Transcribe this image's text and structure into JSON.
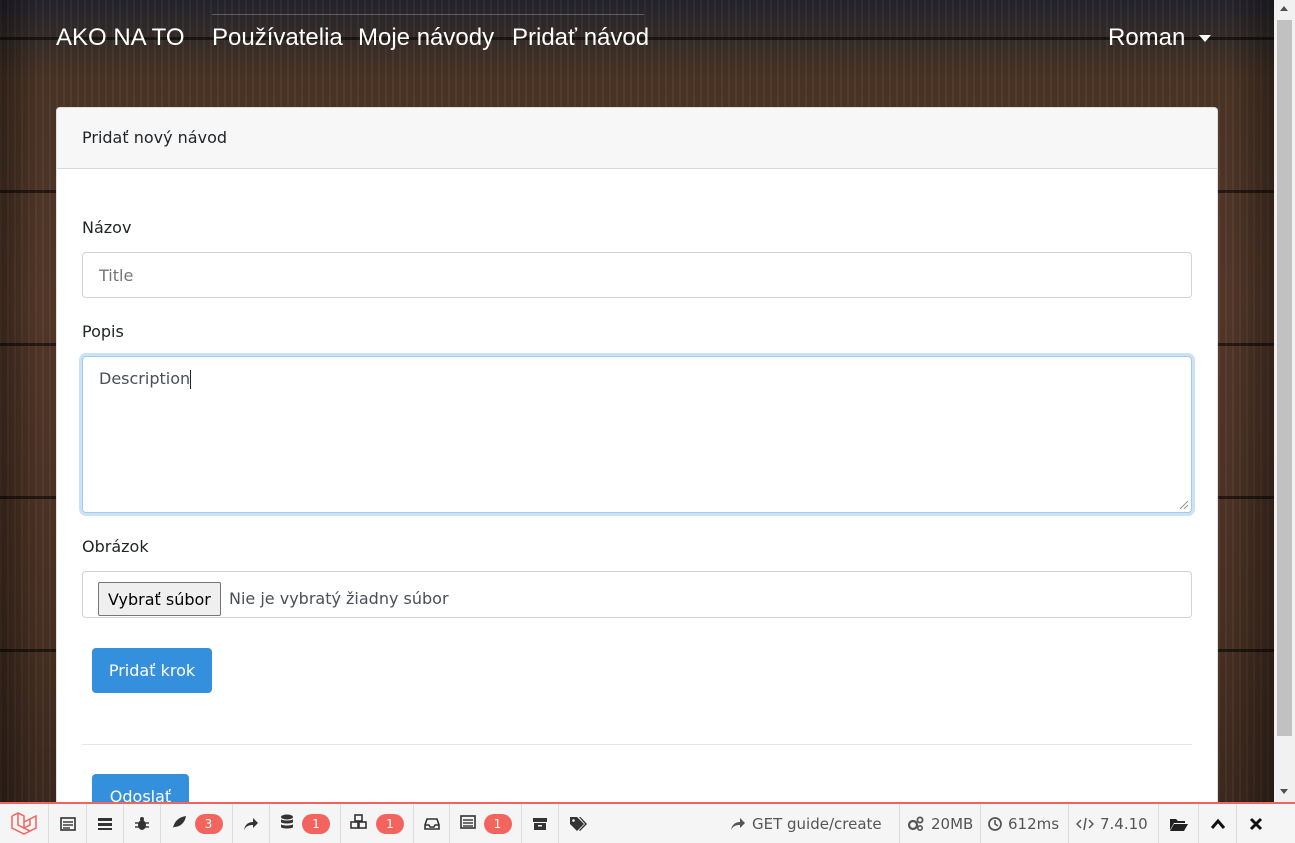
{
  "navbar": {
    "brand": "AKO NA TO",
    "links": [
      "Používatelia",
      "Moje návody",
      "Pridať návod"
    ],
    "user": "Roman"
  },
  "card": {
    "header": "Pridať nový návod",
    "title_label": "Názov",
    "title_placeholder": "Title",
    "description_label": "Popis",
    "description_value": "Description",
    "image_label": "Obrázok",
    "file_button": "Vybrať súbor",
    "file_status": "Nie je vybratý žiadny súbor",
    "add_step_button": "Pridať krok",
    "submit_button": "Odoslať"
  },
  "debugbar": {
    "badges": {
      "views": "3",
      "queries": "1",
      "models": "1",
      "gate": "1"
    },
    "route": "GET guide/create",
    "memory": "20MB",
    "time": "612ms",
    "php_version": "7.4.10"
  },
  "colors": {
    "primary": "#3490dc",
    "debugbar_accent": "#f4645f"
  }
}
